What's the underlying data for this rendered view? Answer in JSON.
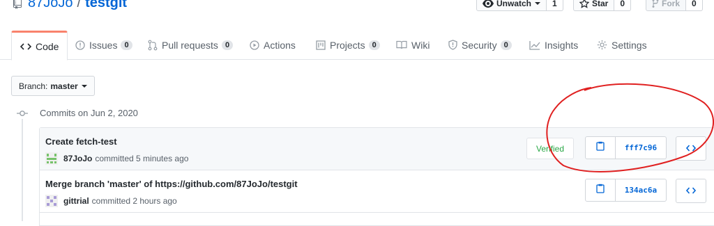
{
  "repo": {
    "owner": "87JoJo",
    "separator": "/",
    "name": "testgit"
  },
  "actions": {
    "watch": {
      "label": "Unwatch",
      "count": "1"
    },
    "star": {
      "label": "Star",
      "count": "0"
    },
    "fork": {
      "label": "Fork",
      "count": "0"
    }
  },
  "tabs": [
    {
      "label": "Code",
      "icon": "code-icon"
    },
    {
      "label": "Issues",
      "icon": "issue-icon",
      "counter": "0"
    },
    {
      "label": "Pull requests",
      "icon": "pull-request-icon",
      "counter": "0"
    },
    {
      "label": "Actions",
      "icon": "play-icon"
    },
    {
      "label": "Projects",
      "icon": "project-icon",
      "counter": "0"
    },
    {
      "label": "Wiki",
      "icon": "book-icon"
    },
    {
      "label": "Security",
      "icon": "shield-icon",
      "counter": "0"
    },
    {
      "label": "Insights",
      "icon": "graph-icon"
    },
    {
      "label": "Settings",
      "icon": "gear-icon"
    }
  ],
  "branch": {
    "label": "Branch:",
    "value": "master"
  },
  "commits_heading": "Commits on Jun 2, 2020",
  "commits": [
    {
      "message": "Create fetch-test",
      "author": "87JoJo",
      "action": "committed 5 minutes ago",
      "verified": "Verified",
      "sha": "fff7c96"
    },
    {
      "message": "Merge branch 'master' of https://github.com/87JoJo/testgit",
      "author": "gittrial",
      "action": "committed 2 hours ago",
      "sha": "134ac6a"
    }
  ],
  "colors": {
    "link": "#0366d6",
    "verified": "#28a745",
    "tab_accent": "#f9826c",
    "annotation": "#e02020"
  }
}
